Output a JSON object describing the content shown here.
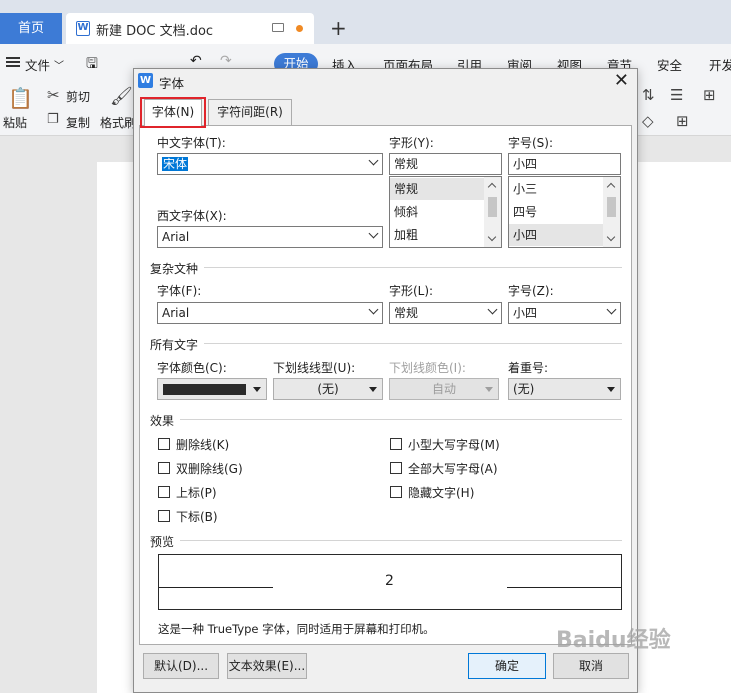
{
  "app": {
    "tabs": {
      "home": "首页",
      "document": "新建 DOC 文档.doc"
    },
    "menu": {
      "file": "文件",
      "start": "开始",
      "insert": "插入",
      "layout": "页面布局",
      "references": "引用",
      "review": "审阅",
      "view": "视图",
      "section": "章节",
      "security": "安全",
      "dev": "开发"
    },
    "ribbon": {
      "paste": "粘贴",
      "cut": "剪切",
      "copy": "复制",
      "format": "格式刷"
    }
  },
  "dialog": {
    "title": "字体",
    "tabs": [
      "字体(N)",
      "字符间距(R)"
    ],
    "chinese_font": {
      "label": "中文字体(T):",
      "value": "宋体"
    },
    "style": {
      "label": "字形(Y):",
      "value": "常规",
      "options": [
        "常规",
        "倾斜",
        "加粗"
      ]
    },
    "size": {
      "label": "字号(S):",
      "value": "小四",
      "options": [
        "小三",
        "四号",
        "小四"
      ]
    },
    "western_font": {
      "label": "西文字体(X):",
      "value": "Arial"
    },
    "complex_section": "复杂文种",
    "complex_font": {
      "label": "字体(F):",
      "value": "Arial"
    },
    "complex_style": {
      "label": "字形(L):",
      "value": "常规"
    },
    "complex_size": {
      "label": "字号(Z):",
      "value": "小四"
    },
    "all_text_section": "所有文字",
    "font_color": {
      "label": "字体颜色(C):",
      "color": "#2a2a2a"
    },
    "underline_type": {
      "label": "下划线线型(U):",
      "value": "(无)"
    },
    "underline_color": {
      "label": "下划线颜色(I):",
      "value": "自动"
    },
    "emphasis": {
      "label": "着重号:",
      "value": "(无)"
    },
    "effects_section": "效果",
    "effects_left": [
      "删除线(K)",
      "双删除线(G)",
      "上标(P)",
      "下标(B)"
    ],
    "effects_right": [
      "小型大写字母(M)",
      "全部大写字母(A)",
      "隐藏文字(H)"
    ],
    "preview_section": "预览",
    "preview_text": "2",
    "description": "这是一种 TrueType 字体，同时适用于屏幕和打印机。",
    "buttons": {
      "default": "默认(D)...",
      "text_effect": "文本效果(E)...",
      "ok": "确定",
      "cancel": "取消"
    }
  },
  "watermark": "Baidu经验"
}
